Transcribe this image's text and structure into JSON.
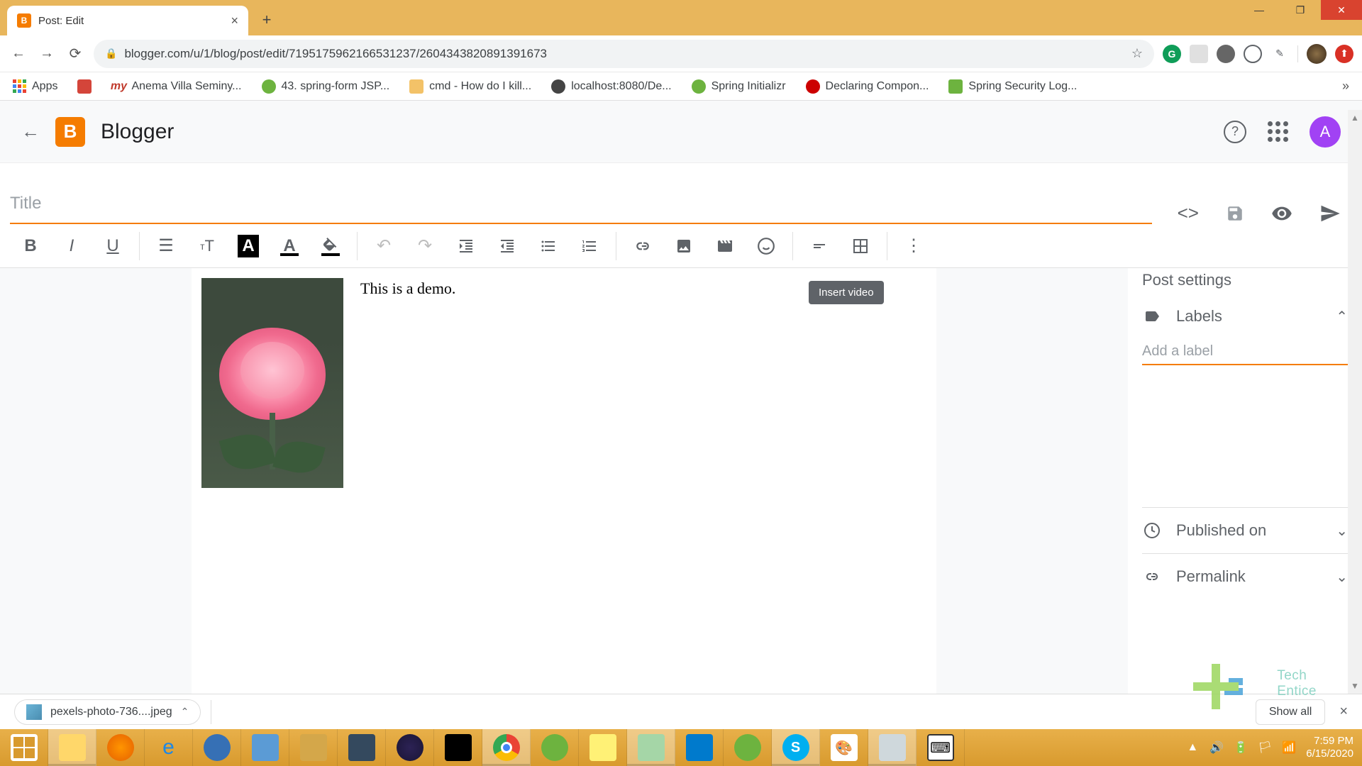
{
  "window": {
    "tab_title": "Post: Edit",
    "minimize": "—",
    "maximize": "❐",
    "close": "✕"
  },
  "browser": {
    "url": "blogger.com/u/1/blog/post/edit/7195175962166531237/2604343820891391673",
    "bookmarks": [
      {
        "label": "Apps"
      },
      {
        "label": ""
      },
      {
        "label": "Anema Villa Seminy..."
      },
      {
        "label": "43. spring-form JSP..."
      },
      {
        "label": "cmd - How do I kill..."
      },
      {
        "label": "localhost:8080/De..."
      },
      {
        "label": "Spring Initializr"
      },
      {
        "label": "Declaring Compon..."
      },
      {
        "label": "Spring Security Log..."
      }
    ],
    "overflow": "»"
  },
  "blogger": {
    "app_name": "Blogger",
    "avatar_letter": "A",
    "title_placeholder": "Title",
    "title_value": "",
    "tooltip": "Insert video",
    "content_text": "This is a demo.",
    "sidebar": {
      "heading": "Post settings",
      "labels_label": "Labels",
      "labels_placeholder": "Add a label",
      "published_label": "Published on",
      "permalink_label": "Permalink"
    }
  },
  "download": {
    "filename": "pexels-photo-736....jpeg",
    "show_all": "Show all"
  },
  "watermark": "Tech Entice",
  "tray": {
    "time": "7:59 PM",
    "date": "6/15/2020"
  }
}
